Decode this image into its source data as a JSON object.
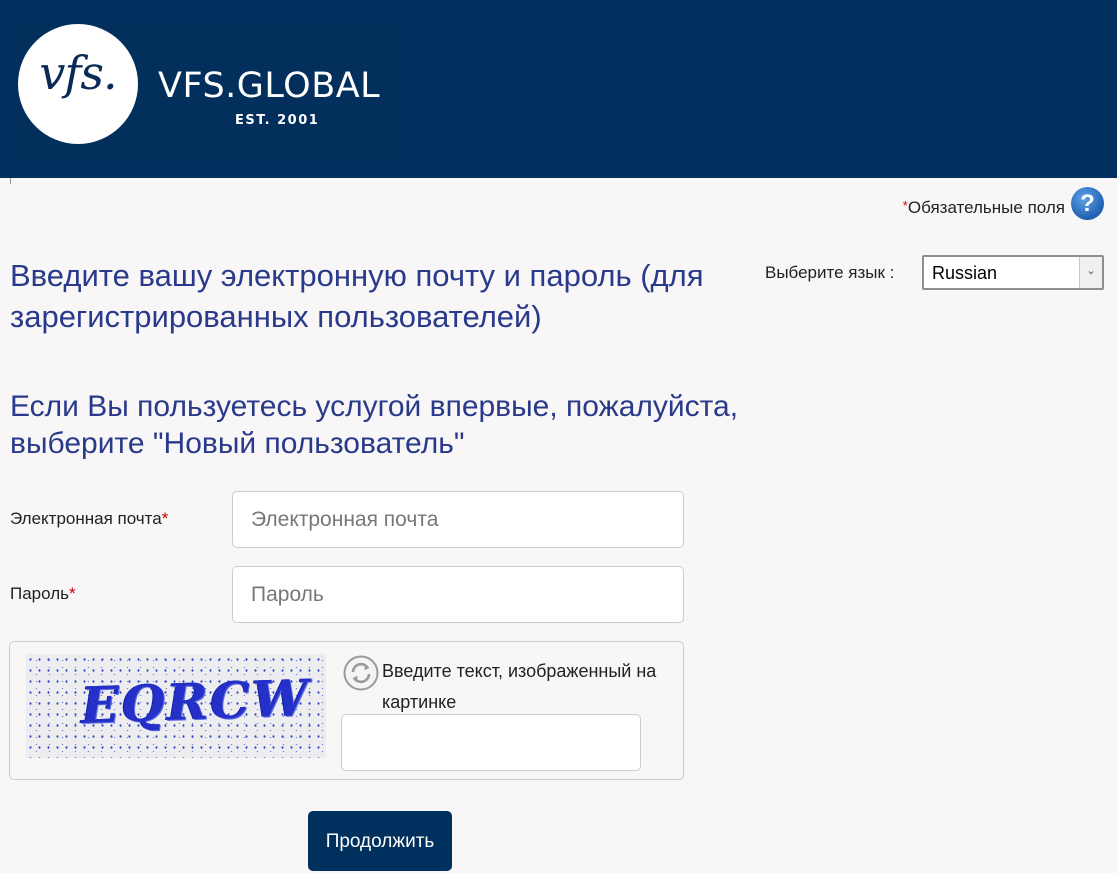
{
  "header": {
    "logo_mark": "vfs.",
    "brand_name": "VFS.GLOBAL",
    "brand_est": "EST. 2001",
    "background_color": "#00305e"
  },
  "required_note": {
    "star": "*",
    "text": "Обязательные поля",
    "help_icon": "question-mark-icon",
    "help_symbol": "?"
  },
  "headings": {
    "login": "Введите вашу электронную почту и пароль (для зарегистрированных пользователей)",
    "new_user": "Если Вы пользуетесь услугой впервые, пожалуйста, выберите \"Новый пользователь\""
  },
  "language": {
    "label": "Выберите язык :",
    "selected": "Russian",
    "arrow_icon": "chevron-down-icon"
  },
  "form": {
    "email": {
      "label": "Электронная почта",
      "required_star": "*",
      "placeholder": "Электронная почта",
      "value": ""
    },
    "password": {
      "label": "Пароль",
      "required_star": "*",
      "placeholder": "Пароль",
      "value": ""
    },
    "captcha": {
      "image_text": "EQRCW",
      "refresh_icon": "refresh-icon",
      "label": "Введите текст, изображенный на картинке",
      "value": ""
    },
    "submit_label": "Продолжить"
  }
}
